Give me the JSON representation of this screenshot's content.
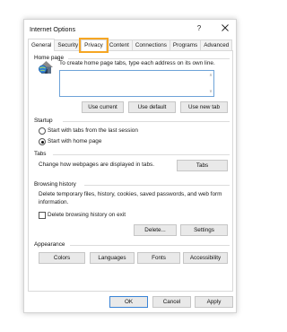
{
  "window": {
    "title": "Internet Options",
    "help_label": "?"
  },
  "tabs": [
    {
      "label": "General",
      "selected": true
    },
    {
      "label": "Security",
      "selected": false
    },
    {
      "label": "Privacy",
      "selected": false,
      "highlighted": true
    },
    {
      "label": "Content",
      "selected": false
    },
    {
      "label": "Connections",
      "selected": false
    },
    {
      "label": "Programs",
      "selected": false
    },
    {
      "label": "Advanced",
      "selected": false
    }
  ],
  "home_page": {
    "header": "Home page",
    "description": "To create home page tabs, type each address on its own line.",
    "addresses_value": "",
    "buttons": {
      "use_current": "Use current",
      "use_default": "Use default",
      "use_new_tab": "Use new tab"
    }
  },
  "startup": {
    "header": "Startup",
    "options": [
      {
        "label": "Start with tabs from the last session",
        "checked": false
      },
      {
        "label": "Start with home page",
        "checked": true
      }
    ]
  },
  "tabs_section": {
    "header": "Tabs",
    "description": "Change how webpages are displayed in tabs.",
    "button": "Tabs"
  },
  "browsing_history": {
    "header": "Browsing history",
    "description": "Delete temporary files, history, cookies, saved passwords, and web form information.",
    "checkbox_label": "Delete browsing history on exit",
    "checkbox_checked": false,
    "delete_button": "Delete...",
    "settings_button": "Settings"
  },
  "appearance": {
    "header": "Appearance",
    "buttons": {
      "colors": "Colors",
      "languages": "Languages",
      "fonts": "Fonts",
      "accessibility": "Accessibility"
    }
  },
  "footer": {
    "ok": "OK",
    "cancel": "Cancel",
    "apply": "Apply"
  },
  "colors": {
    "accent_focus": "#3b84d6",
    "highlight_outline": "#f6a623",
    "button_face": "#e9e9e9"
  }
}
